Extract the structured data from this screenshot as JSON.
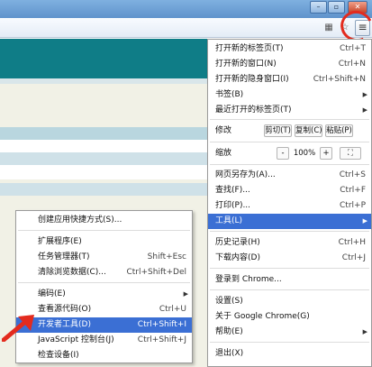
{
  "window": {
    "minimize_glyph": "–",
    "restore_glyph": "▫",
    "close_glyph": "✕"
  },
  "toolbar": {
    "extension_icon": "translate-icon",
    "star_icon": "star-icon",
    "menu_glyph": "≡"
  },
  "colors": {
    "teal_band": "#0f7d87",
    "light_band": "#b9d6df",
    "menu_highlight": "#3b6fd4",
    "annotation_red": "#e32b1e"
  },
  "main_menu": {
    "new_tab": {
      "label": "打开新的标签页(T)",
      "shortcut": "Ctrl+T"
    },
    "new_window": {
      "label": "打开新的窗口(N)",
      "shortcut": "Ctrl+N"
    },
    "new_incognito": {
      "label": "打开新的隐身窗口(I)",
      "shortcut": "Ctrl+Shift+N"
    },
    "bookmarks": {
      "label": "书签(B)"
    },
    "recent_tabs": {
      "label": "最近打开的标签页(T)"
    },
    "edit": {
      "label": "修改",
      "cut": "剪切(T)",
      "copy": "复制(C)",
      "paste": "粘贴(P)"
    },
    "zoom": {
      "label": "缩放",
      "minus": "-",
      "value": "100%",
      "plus": "+",
      "fullscreen": "⛶"
    },
    "save_page": {
      "label": "网页另存为(A)...",
      "shortcut": "Ctrl+S"
    },
    "find": {
      "label": "查找(F)...",
      "shortcut": "Ctrl+F"
    },
    "print": {
      "label": "打印(P)...",
      "shortcut": "Ctrl+P"
    },
    "tools": {
      "label": "工具(L)"
    },
    "history": {
      "label": "历史记录(H)",
      "shortcut": "Ctrl+H"
    },
    "downloads": {
      "label": "下载内容(D)",
      "shortcut": "Ctrl+J"
    },
    "sign_in": {
      "label": "登录到 Chrome..."
    },
    "settings": {
      "label": "设置(S)"
    },
    "about": {
      "label": "关于 Google Chrome(G)"
    },
    "help": {
      "label": "帮助(E)"
    },
    "exit": {
      "label": "退出(X)"
    }
  },
  "sub_menu": {
    "create_shortcut": {
      "label": "创建应用快捷方式(S)..."
    },
    "extensions": {
      "label": "扩展程序(E)"
    },
    "task_manager": {
      "label": "任务管理器(T)",
      "shortcut": "Shift+Esc"
    },
    "clear_data": {
      "label": "清除浏览数据(C)...",
      "shortcut": "Ctrl+Shift+Del"
    },
    "encoding": {
      "label": "编码(E)"
    },
    "view_source": {
      "label": "查看源代码(O)",
      "shortcut": "Ctrl+U"
    },
    "dev_tools": {
      "label": "开发者工具(D)",
      "shortcut": "Ctrl+Shift+I"
    },
    "js_console": {
      "label": "JavaScript 控制台(J)",
      "shortcut": "Ctrl+Shift+J"
    },
    "inspect_devices": {
      "label": "检查设备(I)"
    }
  }
}
